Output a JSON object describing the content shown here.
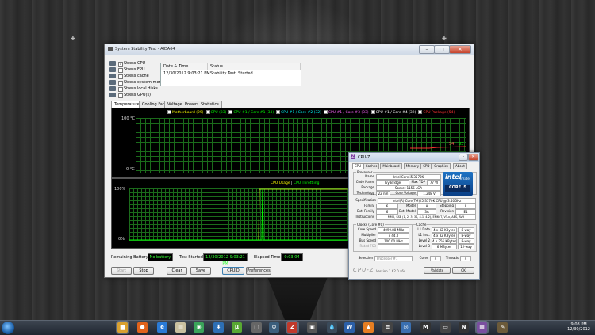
{
  "aida": {
    "title": "System Stability Test - AIDA64",
    "stress": [
      {
        "label": "Stress CPU",
        "checked": true
      },
      {
        "label": "Stress FPU",
        "checked": false
      },
      {
        "label": "Stress cache",
        "checked": false
      },
      {
        "label": "Stress system memory",
        "checked": false
      },
      {
        "label": "Stress local disks",
        "checked": false
      },
      {
        "label": "Stress GPU(s)",
        "checked": false
      }
    ],
    "log": {
      "headers": [
        "Date & Time",
        "Status"
      ],
      "rows": [
        [
          "12/30/2012 9:03:21 PM",
          "Stability Test: Started"
        ]
      ]
    },
    "tabs": [
      "Temperatures",
      "Cooling Fans",
      "Voltages",
      "Powers",
      "Statistics"
    ],
    "temp_chart": {
      "ymax_label": "100 °C",
      "ymin_label": "0 °C",
      "legend": [
        {
          "label": "Motherboard (29)",
          "color": "#ffff00",
          "checked": true
        },
        {
          "label": "CPU (33)",
          "color": "#00ff00",
          "checked": true
        },
        {
          "label": "CPU #1 / Core #1 (33)",
          "color": "#00ff00",
          "checked": true
        },
        {
          "label": "CPU #1 / Core #2 (32)",
          "color": "#00ffff",
          "checked": true
        },
        {
          "label": "CPU #1 / Core #3 (33)",
          "color": "#ff66ff",
          "checked": true
        },
        {
          "label": "CPU #1 / Core #4 (32)",
          "color": "#ffffff",
          "checked": true
        },
        {
          "label": "CPU Package (54)",
          "color": "#ff3333",
          "checked": true
        }
      ],
      "end_readouts": [
        "54",
        "33",
        "31",
        "29"
      ]
    },
    "usage_chart": {
      "title_a": "CPU Usage",
      "sep": "|",
      "title_b": "CPU Throttling",
      "ymax_label": "100%",
      "ymin_label": "0%",
      "end_readouts": [
        "100%",
        "0%"
      ]
    },
    "status": {
      "battery_label": "Remaining Battery:",
      "battery_value": "No battery",
      "started_label": "Test Started:",
      "started_value": "12/30/2012 9:03:21 PM",
      "elapsed_label": "Elapsed Time:",
      "elapsed_value": "0:03:04"
    },
    "buttons": [
      "Start",
      "Stop",
      "Clear",
      "Save",
      "CPUID",
      "Preferences"
    ]
  },
  "cpuz": {
    "title": "CPU-Z",
    "tabs": [
      "CPU",
      "Caches",
      "Mainboard",
      "Memory",
      "SPD",
      "Graphics",
      "About"
    ],
    "processor_group": "Processor",
    "name_label": "Name",
    "name": "Intel Core i5 3570K",
    "codename_label": "Code Name",
    "codename": "Ivy Bridge",
    "maxtdp_label": "Max TDP",
    "maxtdp": "77 W",
    "package_label": "Package",
    "package": "Socket 1155 LGA",
    "tech_label": "Technology",
    "tech": "22 nm",
    "corevolt_label": "Core Voltage",
    "corevolt": "1.248 V",
    "spec_label": "Specification",
    "spec": "Intel(R) Core(TM) i5-3570K CPU @ 3.40GHz",
    "family_label": "Family",
    "family": "6",
    "model_label": "Model",
    "model": "A",
    "stepping_label": "Stepping",
    "stepping": "9",
    "extfamily_label": "Ext. Family",
    "extfamily": "6",
    "extmodel_label": "Ext. Model",
    "extmodel": "3A",
    "revision_label": "Revision",
    "revision": "E1",
    "instr_label": "Instructions",
    "instr": "MMX, SSE (1, 2, 3, 3S, 4.1, 4.2), EM64T, VT-x, AES, AVX",
    "clocks_group": "Clocks (Core #0)",
    "corespeed_label": "Core Speed",
    "corespeed": "4099.88 MHz",
    "mult_label": "Multiplier",
    "mult": "x 44.0",
    "bus_label": "Bus Speed",
    "bus": "100.00 MHz",
    "fsb_label": "Rated FSB",
    "cache_group": "Cache",
    "cache": [
      {
        "label": "L1 Data",
        "size": "4 x 32 KBytes",
        "way": "8-way"
      },
      {
        "label": "L1 Inst.",
        "size": "4 x 32 KBytes",
        "way": "8-way"
      },
      {
        "label": "Level 2",
        "size": "4 x 256 KBytes",
        "way": "8-way"
      },
      {
        "label": "Level 3",
        "size": "6 MBytes",
        "way": "12-way"
      }
    ],
    "selection_label": "Selection",
    "selection": "Processor #1",
    "cores_label": "Cores",
    "cores": "4",
    "threads_label": "Threads",
    "threads": "4",
    "logo": "CPU-Z",
    "version": "Version 1.62.0.x64",
    "validate": "Validate",
    "ok": "OK",
    "intel_brand": "intel",
    "intel_inside": "inside",
    "intel_core": "CORE i5"
  },
  "taskbar": {
    "time": "9:08 PM",
    "date": "12/30/2012",
    "icons": [
      {
        "name": "folder",
        "color": "#d8a030",
        "glyph": "▆"
      },
      {
        "name": "firefox",
        "color": "#e0621b",
        "glyph": "●"
      },
      {
        "name": "ie",
        "color": "#2a7ad6",
        "glyph": "e"
      },
      {
        "name": "files",
        "color": "#c9c0a0",
        "glyph": "▤"
      },
      {
        "name": "chrome",
        "color": "#3aa35a",
        "glyph": "◉"
      },
      {
        "name": "downloader",
        "color": "#2d6fb5",
        "glyph": "⬇"
      },
      {
        "name": "utorrent",
        "color": "#58a832",
        "glyph": "µ"
      },
      {
        "name": "app",
        "color": "#666",
        "glyph": "▢"
      },
      {
        "name": "steam",
        "color": "#3b5e7c",
        "glyph": "⚙"
      },
      {
        "name": "cpuz",
        "color": "#c0392b",
        "glyph": "Z"
      },
      {
        "name": "app2",
        "color": "#555",
        "glyph": "▣"
      },
      {
        "name": "waterdrop",
        "color": "#3a4a5a",
        "glyph": "💧"
      },
      {
        "name": "word",
        "color": "#2b5fa8",
        "glyph": "W"
      },
      {
        "name": "vlc",
        "color": "#e67e22",
        "glyph": "▲"
      },
      {
        "name": "winamp",
        "color": "#444",
        "glyph": "≡"
      },
      {
        "name": "app3",
        "color": "#3a6fb0",
        "glyph": "◎"
      },
      {
        "name": "gamepad",
        "color": "#333",
        "glyph": "M"
      },
      {
        "name": "monitor",
        "color": "#444",
        "glyph": "▭"
      },
      {
        "name": "nvidia",
        "color": "#333",
        "glyph": "N"
      },
      {
        "name": "aida",
        "color": "#7a4fa0",
        "glyph": "▦"
      },
      {
        "name": "tool",
        "color": "#6b5a3a",
        "glyph": "✎"
      }
    ]
  }
}
